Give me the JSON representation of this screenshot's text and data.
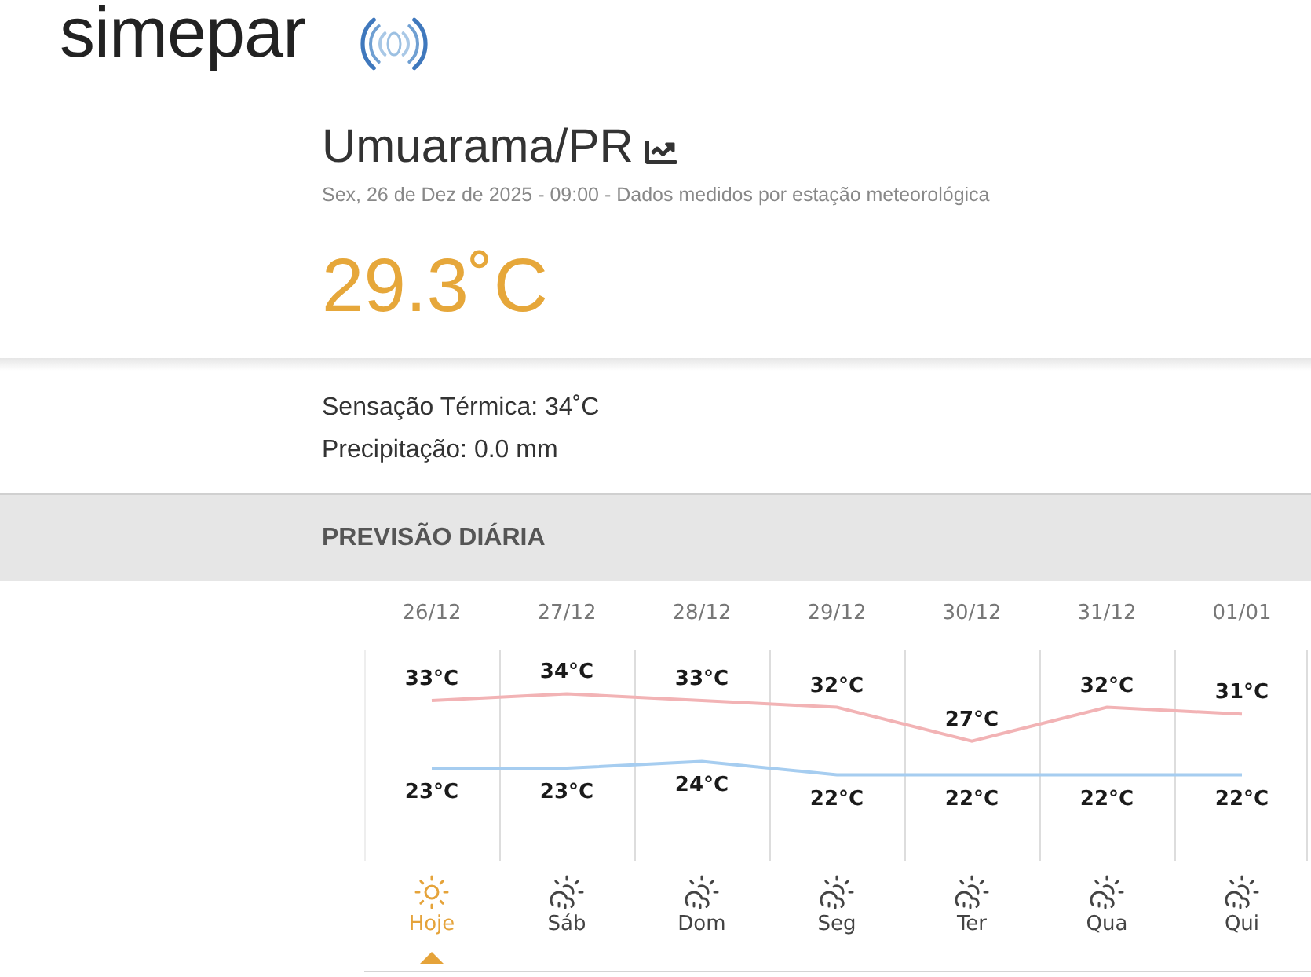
{
  "header": {
    "logo": "simepar"
  },
  "current": {
    "city": "Umuarama/PR",
    "subtitle": "Sex, 26 de Dez de 2025 - 09:00 - Dados medidos por estação meteorológica",
    "temperature": "29.3˚C"
  },
  "details": [
    "Sensação Térmica: 34˚C",
    "Precipitação: 0.0 mm"
  ],
  "forecast": {
    "title": "PREVISÃO DIÁRIA",
    "chart_data": {
      "type": "line",
      "categories": [
        "26/12",
        "27/12",
        "28/12",
        "29/12",
        "30/12",
        "31/12",
        "01/01"
      ],
      "data_labels": true,
      "series": [
        {
          "color": "#f2b3b5",
          "values": [
            33,
            34,
            33,
            32,
            27,
            32,
            31
          ],
          "value_labels": [
            "33°C",
            "34°C",
            "33°C",
            "32°C",
            "27°C",
            "32°C",
            "31°C"
          ]
        },
        {
          "color": "#a6cdf0",
          "values": [
            23,
            23,
            24,
            22,
            22,
            22,
            22
          ],
          "value_labels": [
            "23°C",
            "23°C",
            "24°C",
            "22°C",
            "22°C",
            "22°C",
            "22°C"
          ]
        }
      ]
    },
    "days": [
      {
        "label": "Hoje",
        "kind": "sun",
        "selected": true
      },
      {
        "label": "Sáb",
        "kind": "sun-rain",
        "selected": false
      },
      {
        "label": "Dom",
        "kind": "sun-rain",
        "selected": false
      },
      {
        "label": "Seg",
        "kind": "sun-rain",
        "selected": false
      },
      {
        "label": "Ter",
        "kind": "sun-rain",
        "selected": false
      },
      {
        "label": "Qua",
        "kind": "sun-rain",
        "selected": false
      },
      {
        "label": "Qui",
        "kind": "sun-rain",
        "selected": false
      }
    ]
  }
}
